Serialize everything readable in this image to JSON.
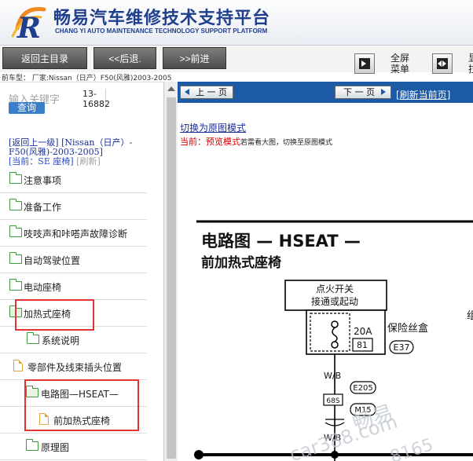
{
  "header": {
    "title_cn": "畅易汽车维修技术支持平台",
    "title_en": "CHANG YI AUTO MAINTENANCE TECHNOLOGY SUPPORT PLATFORM"
  },
  "toolbar": {
    "home": "返回主目录",
    "back": "<<后退.",
    "forward": ">>前进",
    "fullscreen_line1": "全屏",
    "fullscreen_line2": "菜单",
    "partial_line1": "显",
    "partial_line2": "拉"
  },
  "vehicle": "前车型： 厂家:Nissan（日产）F50(风雅)2003-2005",
  "search": {
    "placeholder": "输入关键字",
    "button": "查询",
    "code": "13-16882"
  },
  "nav": {
    "back_link": "[返回上一级]",
    "path": "[Nissan（日产）-F50(风雅)-2003-2005]",
    "current": "[当前：SE 座椅]",
    "refresh": "[刷新]"
  },
  "tree": [
    {
      "label": "注意事项",
      "icon": "folder"
    },
    {
      "label": "准备工作",
      "icon": "folder"
    },
    {
      "label": "吱吱声和咔嗒声故障诊断",
      "icon": "folder"
    },
    {
      "label": "自动驾驶位置",
      "icon": "folder"
    },
    {
      "label": "电动座椅",
      "icon": "folder"
    },
    {
      "label": "加热式座椅",
      "icon": "folder-open"
    },
    {
      "label": "系统说明",
      "icon": "folder"
    },
    {
      "label": "零部件及线束插头位置",
      "icon": "doc"
    },
    {
      "label": "电路图—HSEAT—",
      "icon": "folder-open"
    },
    {
      "label": "前加热式座椅",
      "icon": "doc"
    },
    {
      "label": "原理图",
      "icon": "folder"
    }
  ],
  "content": {
    "prev_page": "上 一 页",
    "next_page": "下 一 页",
    "refresh_page": "[刷新当前页]",
    "switch_mode": "切换为原图模式",
    "status_prefix": "当前：",
    "status_mode": "预览模式",
    "status_hint": "若需看大图，切换至原图模式"
  },
  "diagram": {
    "title": "电路图 — HSEAT —",
    "subtitle": "前加热式座椅",
    "ignition_line1": "点火开关",
    "ignition_line2": "接通或起动",
    "fuse_rating": "20A",
    "fuse_number": "81",
    "fuse_box": "保险丝盒",
    "fuse_connector": "E37",
    "wire": "W/B",
    "connector_1": "E205",
    "connector_2": "68S",
    "connector_3": "M15",
    "side_char": "组",
    "watermark_1": "畅易",
    "watermark_2": "car388.com",
    "watermark_3": "8165"
  }
}
